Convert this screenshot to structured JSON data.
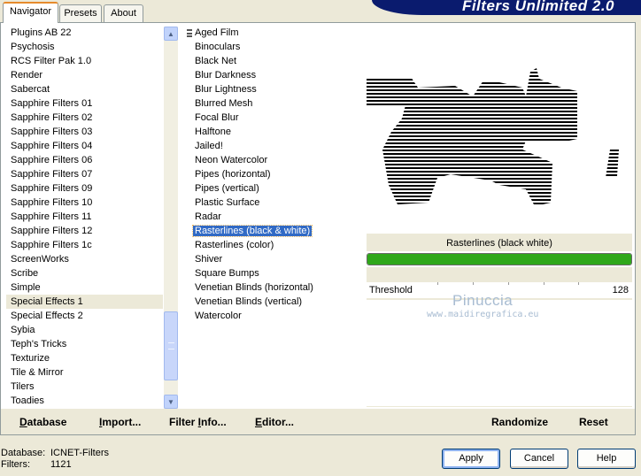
{
  "header": {
    "title": "Filters Unlimited 2.0"
  },
  "tabs": [
    {
      "label": "Navigator",
      "active": true
    },
    {
      "label": "Presets",
      "active": false
    },
    {
      "label": "About",
      "active": false
    }
  ],
  "categories": {
    "items": [
      "Plugins AB 22",
      "Psychosis",
      "RCS Filter Pak 1.0",
      "Render",
      "Sabercat",
      "Sapphire Filters 01",
      "Sapphire Filters 02",
      "Sapphire Filters 03",
      "Sapphire Filters 04",
      "Sapphire Filters 06",
      "Sapphire Filters 07",
      "Sapphire Filters 09",
      "Sapphire Filters 10",
      "Sapphire Filters 11",
      "Sapphire Filters 12",
      "Sapphire Filters 1c",
      "ScreenWorks",
      "Scribe",
      "Simple",
      "Special Effects 1",
      "Special Effects 2",
      "Sybia",
      "Teph's Tricks",
      "Texturize",
      "Tile & Mirror",
      "Tilers",
      "Toadies"
    ],
    "selected": "Special Effects 1"
  },
  "filters": {
    "items": [
      "Aged Film",
      "Binoculars",
      "Black Net",
      "Blur Darkness",
      "Blur Lightness",
      "Blurred Mesh",
      "Focal Blur",
      "Halftone",
      "Jailed!",
      "Neon Watercolor",
      "Pipes (horizontal)",
      "Pipes (vertical)",
      "Plastic Surface",
      "Radar",
      "Rasterlines (black & white)",
      "Rasterlines (color)",
      "Shiver",
      "Square Bumps",
      "Venetian Blinds (horizontal)",
      "Venetian Blinds (vertical)",
      "Watercolor"
    ],
    "selected": "Rasterlines (black & white)"
  },
  "preview": {
    "filter_name": "Rasterlines (black  white)",
    "progress": 1.0
  },
  "params": [
    {
      "label": "Threshold",
      "value": "128"
    }
  ],
  "watermark": {
    "line1": "Pinuccia",
    "line2": "www.maidiregrafica.eu"
  },
  "links": {
    "database": {
      "pre": "",
      "u": "D",
      "post": "atabase"
    },
    "import": {
      "pre": "",
      "u": "I",
      "post": "mport..."
    },
    "filter_info": {
      "pre": "Filter ",
      "u": "I",
      "post": "nfo..."
    },
    "editor": {
      "pre": "",
      "u": "E",
      "post": "ditor..."
    },
    "randomize": "Randomize",
    "reset": "Reset"
  },
  "status": {
    "database_label": "Database:",
    "database_value": "ICNET-Filters",
    "filters_label": "Filters:",
    "filters_value": "1121"
  },
  "buttons": {
    "apply": "Apply",
    "cancel": "Cancel",
    "help": "Help"
  },
  "colors": {
    "banner": "#0a1b6e",
    "selection": "#316ac5",
    "progress": "#2fa71a",
    "panel": "#ece9d8"
  }
}
